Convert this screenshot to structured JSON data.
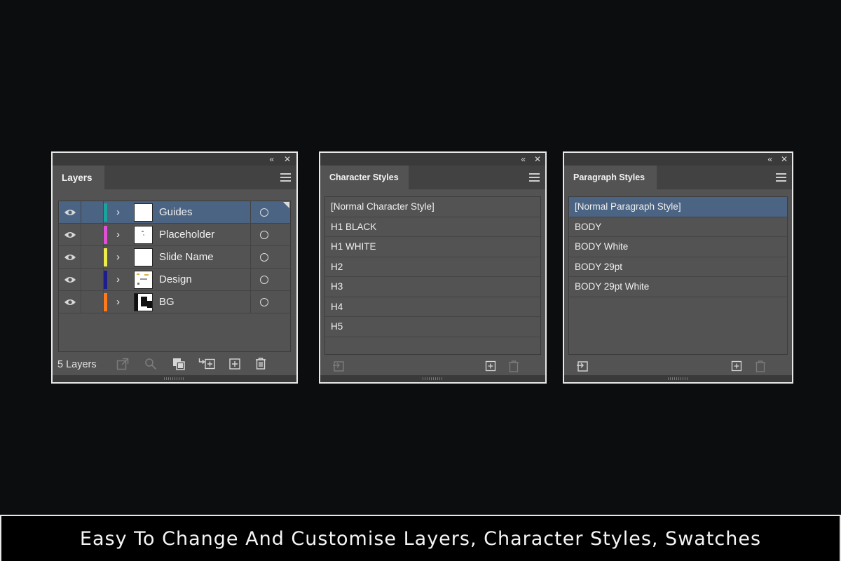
{
  "layers_panel": {
    "tab": "Layers",
    "layers": [
      {
        "name": "Guides",
        "color": "#1aa39a",
        "selected": true
      },
      {
        "name": "Placeholder",
        "color": "#e04fd6",
        "selected": false
      },
      {
        "name": "Slide Name",
        "color": "#ecec4a",
        "selected": false
      },
      {
        "name": "Design",
        "color": "#1d1d8f",
        "selected": false
      },
      {
        "name": "BG",
        "color": "#ff7a1a",
        "selected": false
      }
    ],
    "count": "5 Layers"
  },
  "character_styles_panel": {
    "tab": "Character Styles",
    "styles": [
      "[Normal Character Style]",
      "H1 BLACK",
      "H1 WHITE",
      "H2",
      "H3",
      "H4",
      "H5"
    ]
  },
  "paragraph_styles_panel": {
    "tab": "Paragraph Styles",
    "styles": [
      "[Normal Paragraph Style]",
      "BODY",
      "BODY White",
      "BODY 29pt",
      "BODY 29pt White"
    ],
    "selected_index": 0
  },
  "caption": "Easy To Change And Customise Layers, Character Styles, Swatches",
  "icons": {
    "collapse": "«",
    "close": "✕",
    "chevron": "›",
    "eye": "eye-icon"
  }
}
